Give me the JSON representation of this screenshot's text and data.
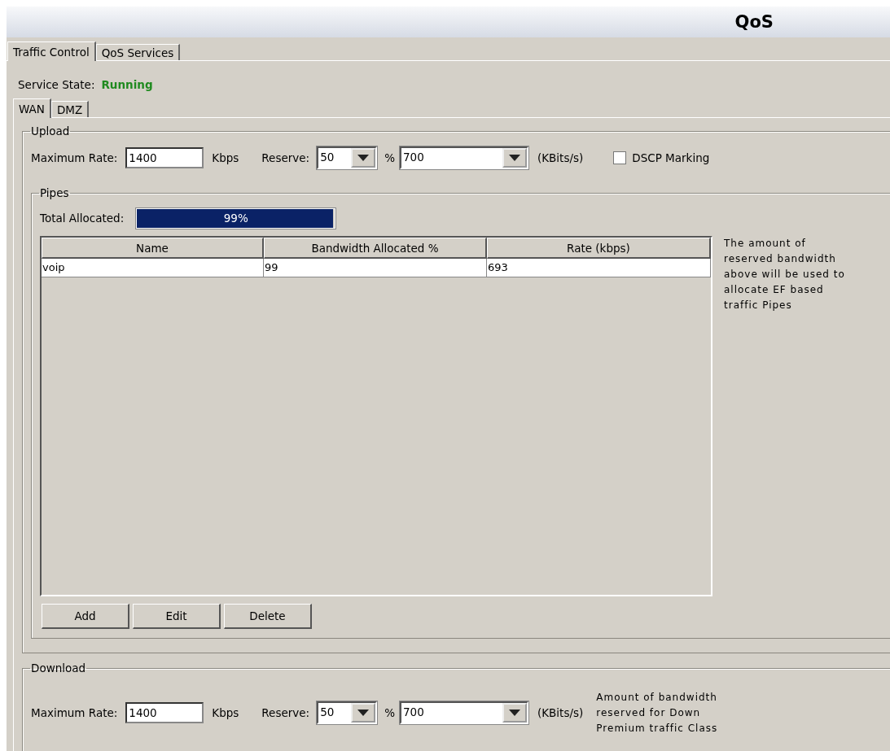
{
  "window": {
    "title": "QoS"
  },
  "tabs": [
    {
      "label": "Traffic Control",
      "selected": true
    },
    {
      "label": "QoS Services",
      "selected": false
    }
  ],
  "service_state": {
    "label": "Service State:",
    "value": "Running"
  },
  "interface_tabs": [
    {
      "label": "WAN",
      "selected": true
    },
    {
      "label": "DMZ",
      "selected": false
    }
  ],
  "upload": {
    "legend": "Upload",
    "max_rate_label": "Maximum Rate:",
    "max_rate": "1400",
    "max_rate_unit": "Kbps",
    "reserve_label": "Reserve:",
    "reserve_percent": "50",
    "percent_sign": "%",
    "reserve_rate": "700",
    "rate_unit": "(KBits/s)",
    "dscp": {
      "label": "DSCP Marking",
      "checked": false
    },
    "pipes": {
      "legend": "Pipes",
      "total_label": "Total Allocated:",
      "level": 0.99,
      "total_text": "99%",
      "columns": [
        "Name",
        "Bandwidth Allocated %",
        "Rate (kbps)"
      ],
      "rows": [
        [
          "voip",
          "99",
          "693"
        ]
      ],
      "note": "The amount of reserved bandwidth above will be used to allocate EF based traffic Pipes",
      "buttons": [
        "Add",
        "Edit",
        "Delete"
      ]
    }
  },
  "download": {
    "legend": "Download",
    "max_rate_label": "Maximum Rate:",
    "max_rate": "1400",
    "max_rate_unit": "Kbps",
    "reserve_label": "Reserve:",
    "reserve_percent": "50",
    "percent_sign": "%",
    "reserve_rate": "700",
    "rate_unit": "(KBits/s)",
    "note": "Amount of bandwidth reserved for Down Premium traffic Class"
  }
}
